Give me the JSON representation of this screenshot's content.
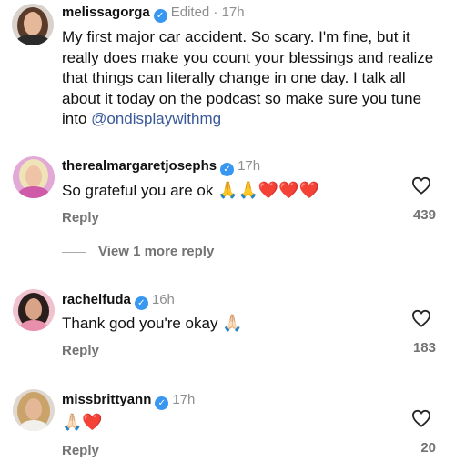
{
  "post": {
    "username": "melissagorga",
    "meta": "Edited · 17h",
    "caption_text": "My first major car accident. So scary. I'm fine, but it really does make you count your blessings and realize that things can literally change in one day. I talk all about it today on the podcast so make sure you tune into ",
    "mention": "@ondisplaywithmg"
  },
  "comments": [
    {
      "username": "therealmargaretjosephs",
      "meta": "17h",
      "text": "So grateful you are ok",
      "emojis": "🙏🙏❤️❤️❤️",
      "reply_label": "Reply",
      "likes": "439",
      "view_more": "View 1 more reply"
    },
    {
      "username": "rachelfuda",
      "meta": "16h",
      "text": "Thank god you're okay",
      "emojis": "🙏🏻",
      "reply_label": "Reply",
      "likes": "183"
    },
    {
      "username": "missbrittyann",
      "meta": "17h",
      "text": "",
      "emojis": "🙏🏻❤️",
      "reply_label": "Reply",
      "likes": "20"
    }
  ],
  "icons": {
    "verified": "verified-badge-icon",
    "like": "heart-outline-icon"
  },
  "colors": {
    "verified": "#3897f0",
    "mention": "#385898",
    "muted": "#737373"
  }
}
